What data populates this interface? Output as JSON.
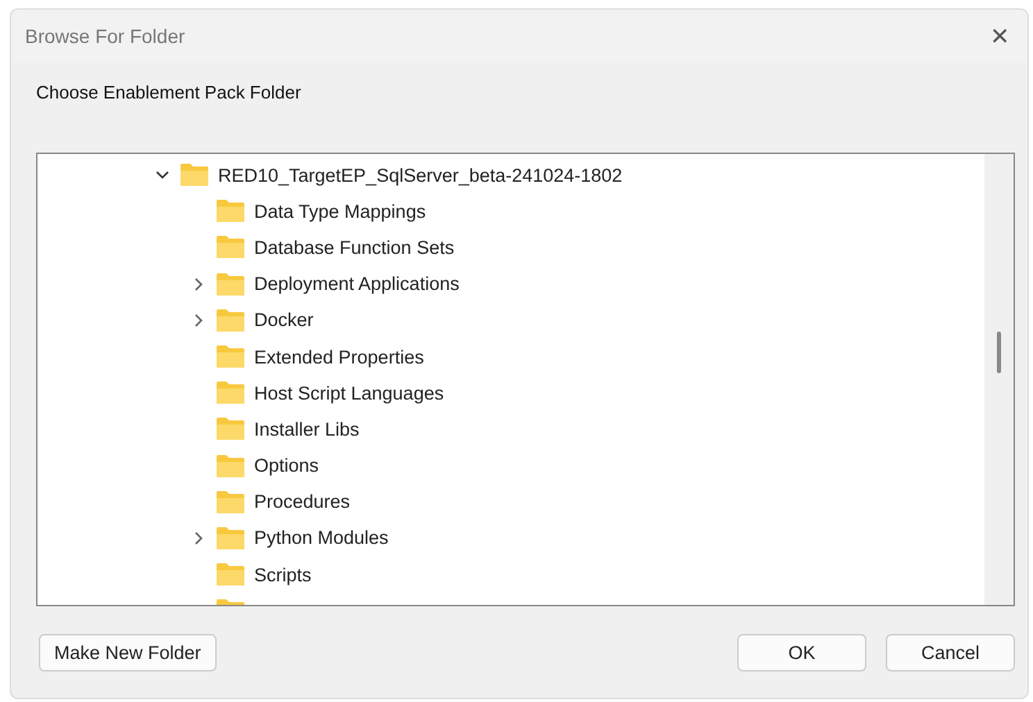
{
  "window": {
    "title": "Browse For Folder",
    "close_glyph": "✕"
  },
  "prompt": "Choose Enablement Pack Folder",
  "tree": [
    {
      "label": "RED10_TargetEP_SqlServer_beta-241024-1802",
      "expanded": true,
      "children": [
        {
          "label": "Data Type Mappings",
          "expandable": false
        },
        {
          "label": "Database Function Sets",
          "expandable": false
        },
        {
          "label": "Deployment Applications",
          "expandable": true,
          "expanded": false
        },
        {
          "label": "Docker",
          "expandable": true,
          "expanded": false
        },
        {
          "label": "Extended Properties",
          "expandable": false
        },
        {
          "label": "Host Script Languages",
          "expandable": false
        },
        {
          "label": "Installer Libs",
          "expandable": false
        },
        {
          "label": "Options",
          "expandable": false
        },
        {
          "label": "Procedures",
          "expandable": false
        },
        {
          "label": "Python Modules",
          "expandable": true,
          "expanded": false
        },
        {
          "label": "Scripts",
          "expandable": false
        },
        {
          "kind": "cut"
        }
      ]
    }
  ],
  "buttons": [
    {
      "label": "Make New Folder",
      "kind": "left"
    },
    {
      "label": "OK",
      "kind": "right"
    },
    {
      "label": "Cancel",
      "kind": "right"
    }
  ]
}
